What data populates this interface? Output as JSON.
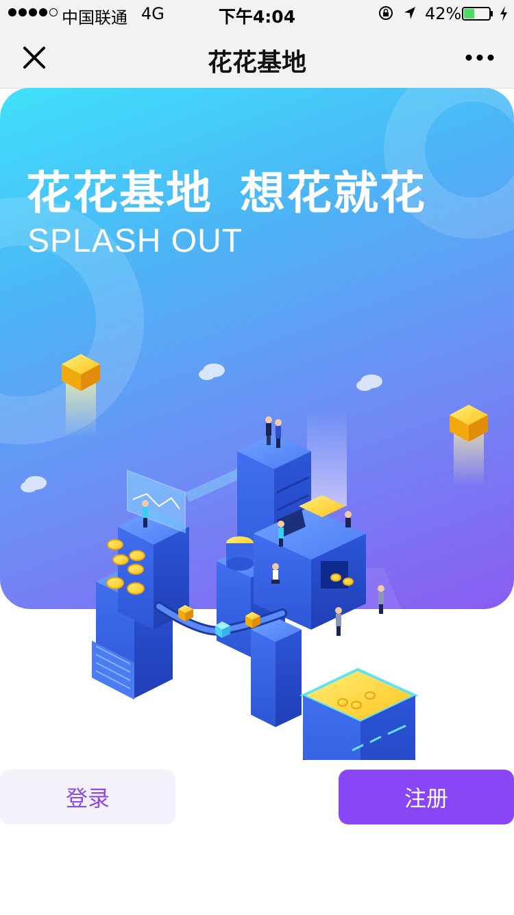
{
  "status_bar": {
    "carrier": "中国联通",
    "network": "4G",
    "time": "下午4:04",
    "battery_percent": "42%",
    "battery_level": 0.42,
    "icons": [
      "signal-dots-icon",
      "lock-rotation-icon",
      "location-arrow-icon",
      "battery-icon",
      "charging-bolt-icon"
    ]
  },
  "nav": {
    "title": "花花基地",
    "icons": [
      "close-icon",
      "more-icon"
    ]
  },
  "banner": {
    "headline_part1": "花花基地",
    "headline_part2": "想花就花",
    "subline": "SPLASH OUT"
  },
  "buttons": {
    "login_label": "登录",
    "register_label": "注册"
  },
  "colors": {
    "accent": "#8a45f6",
    "login_bg": "#f4f1fb",
    "banner_top": "#3fe1fb",
    "banner_bottom": "#8a5cf2",
    "battery_fill": "#4cd964"
  }
}
